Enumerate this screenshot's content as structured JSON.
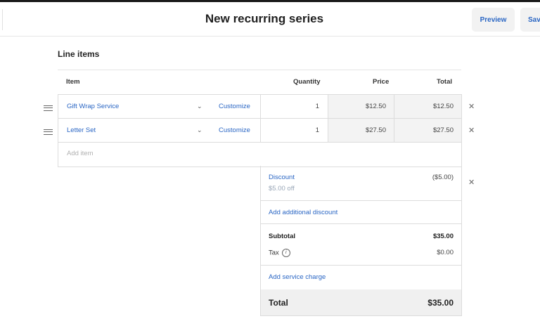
{
  "header": {
    "title": "New recurring series",
    "preview_label": "Preview",
    "save_label": "Save"
  },
  "line_items": {
    "section_title": "Line items",
    "columns": {
      "item": "Item",
      "quantity": "Quantity",
      "price": "Price",
      "total": "Total"
    },
    "rows": [
      {
        "item": "Gift Wrap Service",
        "customize": "Customize",
        "quantity": "1",
        "price": "$12.50",
        "total": "$12.50"
      },
      {
        "item": "Letter Set",
        "customize": "Customize",
        "quantity": "1",
        "price": "$27.50",
        "total": "$27.50"
      }
    ],
    "add_item_placeholder": "Add item"
  },
  "summary": {
    "discount_label": "Discount",
    "discount_sub": "$5.00 off",
    "discount_value": "($5.00)",
    "add_discount": "Add additional discount",
    "subtotal_label": "Subtotal",
    "subtotal_value": "$35.00",
    "tax_label": "Tax",
    "tax_value": "$0.00",
    "add_service_charge": "Add service charge",
    "total_label": "Total",
    "total_value": "$35.00"
  },
  "colors": {
    "link": "#2a66c4",
    "shade": "#f3f3f3"
  },
  "icons": [
    "drag-handle-icon",
    "chevron-down-icon",
    "close-icon",
    "info-icon"
  ]
}
